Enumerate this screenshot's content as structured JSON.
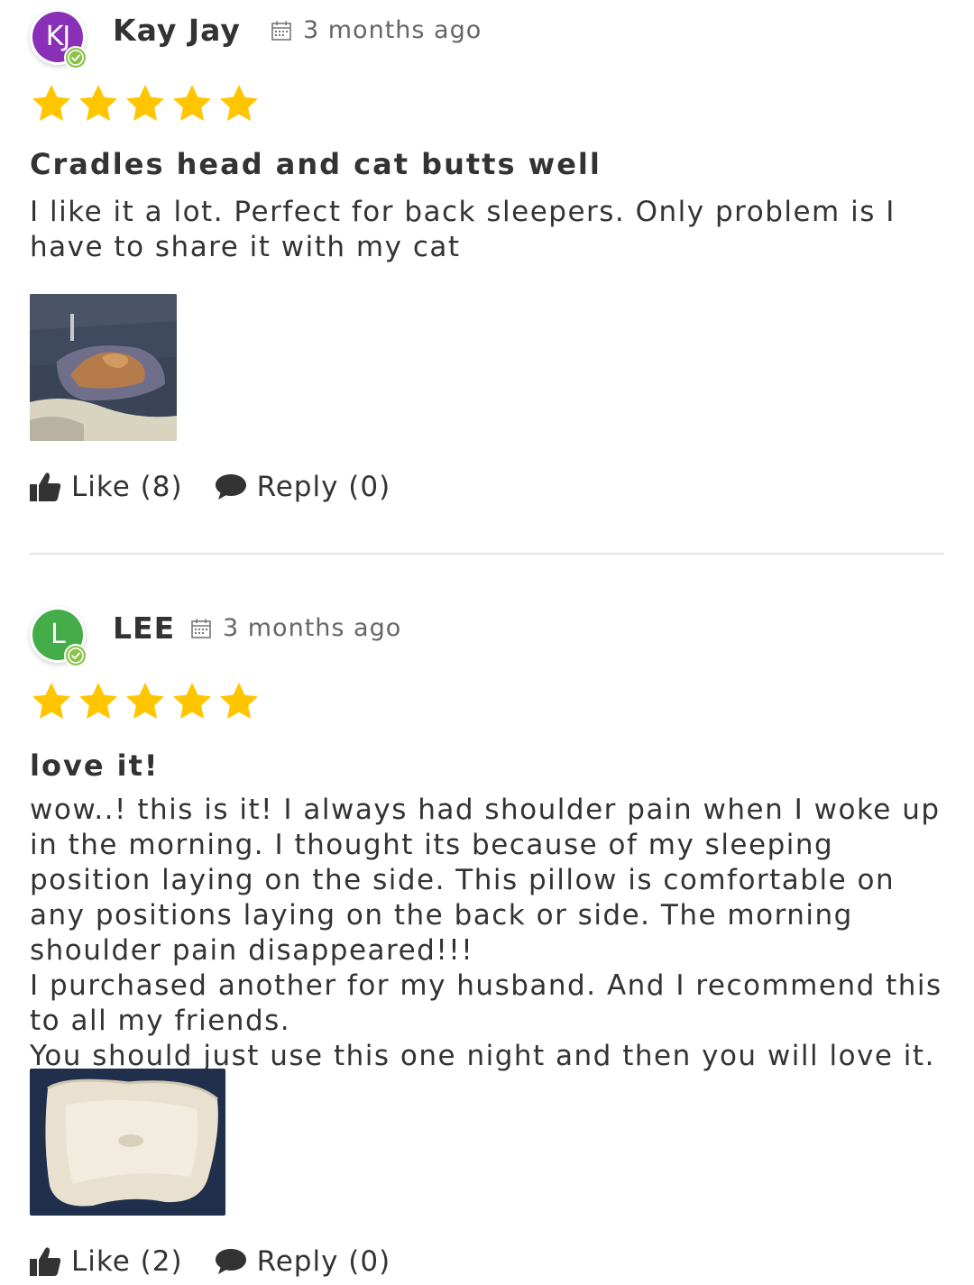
{
  "reviews": [
    {
      "author": "Kay Jay",
      "avatar_initials": "KJ",
      "avatar_color": "#8a2fb8",
      "date": "3 months ago",
      "rating": 5,
      "title": "Cradles head and cat butts well",
      "body": "I like it a lot. Perfect for back sleepers. Only problem is I have to share it with my cat",
      "photo": "cat lying on pillow in bed",
      "like_label": "Like (8)",
      "reply_label": "Reply (0)"
    },
    {
      "author": "LEE",
      "avatar_initials": "L",
      "avatar_color": "#44ad4a",
      "date": "3 months ago",
      "rating": 5,
      "title": "love it!",
      "body": "wow..! this is it! I always had shoulder pain when I woke up in the morning. I thought its because of my sleeping position laying on the side. This pillow is comfortable on any positions laying on the back or side. The morning shoulder pain disappeared!!!\nI purchased another for my husband. And I recommend this to all my friends.\nYou should just use this one night and then you will love it.",
      "photo": "white contoured memory foam pillow",
      "like_label": "Like (2)",
      "reply_label": "Reply (0)"
    }
  ],
  "colors": {
    "star": "#ffc600",
    "verified_badge": "#8bc34a",
    "text": "#333333",
    "muted": "#666666",
    "divider": "#e6e6e6"
  },
  "icons": [
    "calendar-icon",
    "star-icon",
    "thumbs-up-icon",
    "comment-icon",
    "verified-check-icon"
  ]
}
